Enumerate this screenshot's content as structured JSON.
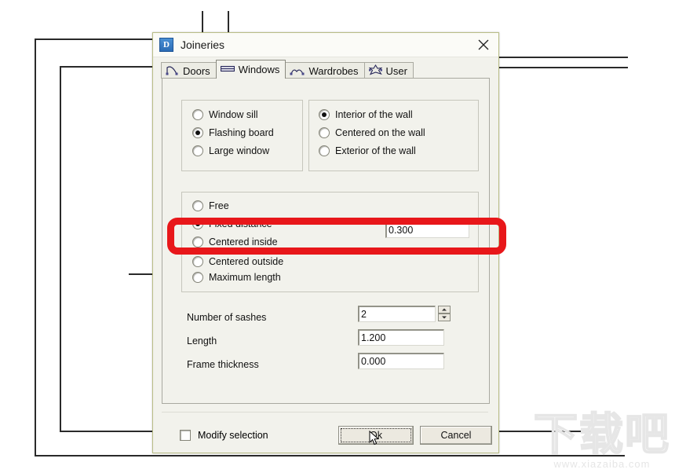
{
  "window": {
    "title": "Joineries",
    "icon": "app-d-icon",
    "icon_letter": "D",
    "close_label": "close-icon",
    "border_color": "#b9bd86",
    "background_color": "#f2f2ec"
  },
  "tabs": [
    {
      "label": "Doors",
      "icon": "door-swing-icon",
      "active": false
    },
    {
      "label": "Windows",
      "icon": "window-icon",
      "active": true
    },
    {
      "label": "Wardrobes",
      "icon": "wardrobe-arc-icon",
      "active": false
    },
    {
      "label": "User",
      "icon": "user-star-icon",
      "active": false
    }
  ],
  "groups": {
    "window_type": {
      "options": [
        {
          "label": "Window sill",
          "checked": false
        },
        {
          "label": "Flashing board",
          "checked": true
        },
        {
          "label": "Large window",
          "checked": false
        }
      ]
    },
    "wall_position": {
      "options": [
        {
          "label": "Interior of the wall",
          "checked": true
        },
        {
          "label": "Centered on the wall",
          "checked": false
        },
        {
          "label": "Exterior of the wall",
          "checked": false
        }
      ]
    },
    "placement": {
      "options": [
        {
          "label": "Free",
          "checked": false
        },
        {
          "label": "Fixed distance",
          "checked": true
        },
        {
          "label": "Centered inside",
          "checked": false
        },
        {
          "label": "Centered outside",
          "checked": false
        },
        {
          "label": "Maximum length",
          "checked": false
        }
      ],
      "fixed_distance_value": "0.300"
    }
  },
  "fields": [
    {
      "label": "Number of sashes",
      "value": "2",
      "spinner": true
    },
    {
      "label": "Length",
      "value": "1.200",
      "spinner": false
    },
    {
      "label": "Frame thickness",
      "value": "0.000",
      "spinner": false
    }
  ],
  "footer": {
    "modify_selection_label": "Modify selection",
    "modify_selection_checked": false,
    "ok_label": "Ok",
    "cancel_label": "Cancel"
  },
  "annotation": {
    "color": "#e8171a",
    "shape": "rounded-rectangle-highlight"
  },
  "watermark": {
    "text_cn": "下载吧",
    "url": "www.xiazaiba.com"
  }
}
